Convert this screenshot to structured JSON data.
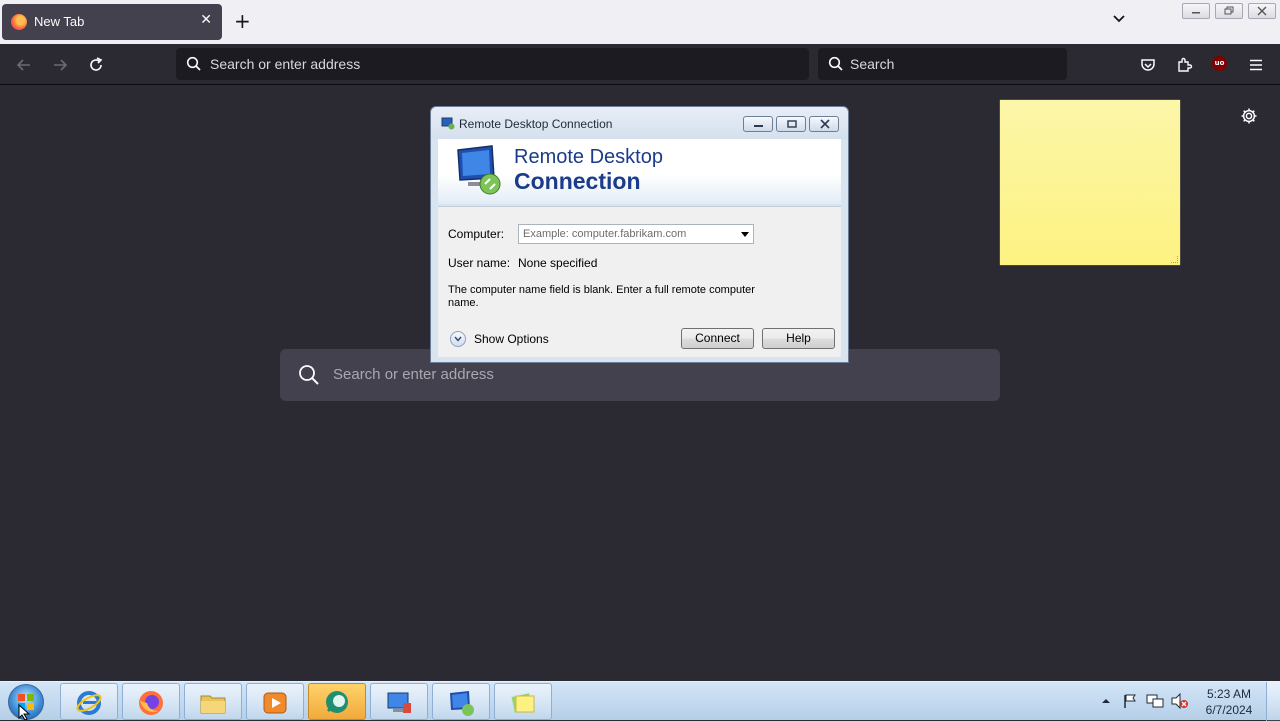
{
  "browser": {
    "tab": {
      "title": "New Tab",
      "close_glyph": "✕",
      "icon": "firefox-icon"
    },
    "new_tab_glyph": "+",
    "url_bar": {
      "placeholder": "Search or enter address"
    },
    "search_bar": {
      "placeholder": "Search"
    },
    "toolbar_icons": [
      "back-icon",
      "forward-icon",
      "reload-icon",
      "pocket-icon",
      "extensions-icon",
      "ublock-icon",
      "menu-icon"
    ],
    "ublock_badge": "uo"
  },
  "newtab_page": {
    "search_placeholder": "Search or enter address"
  },
  "rdc_dialog": {
    "window_title": "Remote Desktop Connection",
    "banner_line1": "Remote Desktop",
    "banner_line2": "Connection",
    "computer_label": "Computer:",
    "computer_placeholder": "Example: computer.fabrikam.com",
    "username_label": "User name:",
    "username_value": "None specified",
    "message": "The computer name field is blank. Enter a full remote computer name.",
    "show_options_label": "Show Options",
    "connect_label": "Connect",
    "help_label": "Help"
  },
  "taskbar": {
    "apps": [
      "internet-explorer",
      "firefox",
      "file-explorer",
      "media-player",
      "teams-chat",
      "remote-desktop-manager",
      "remote-desktop-connection",
      "sticky-notes"
    ],
    "clock_time": "5:23 AM",
    "clock_date": "6/7/2024"
  },
  "colors": {
    "browser_bg": "#2b2a33",
    "tabstrip_bg": "#f0f0f4",
    "sticky_note": "#fdf281",
    "rdc_banner_text": "#1a3c8a",
    "taskbar": "#c4daf0"
  }
}
